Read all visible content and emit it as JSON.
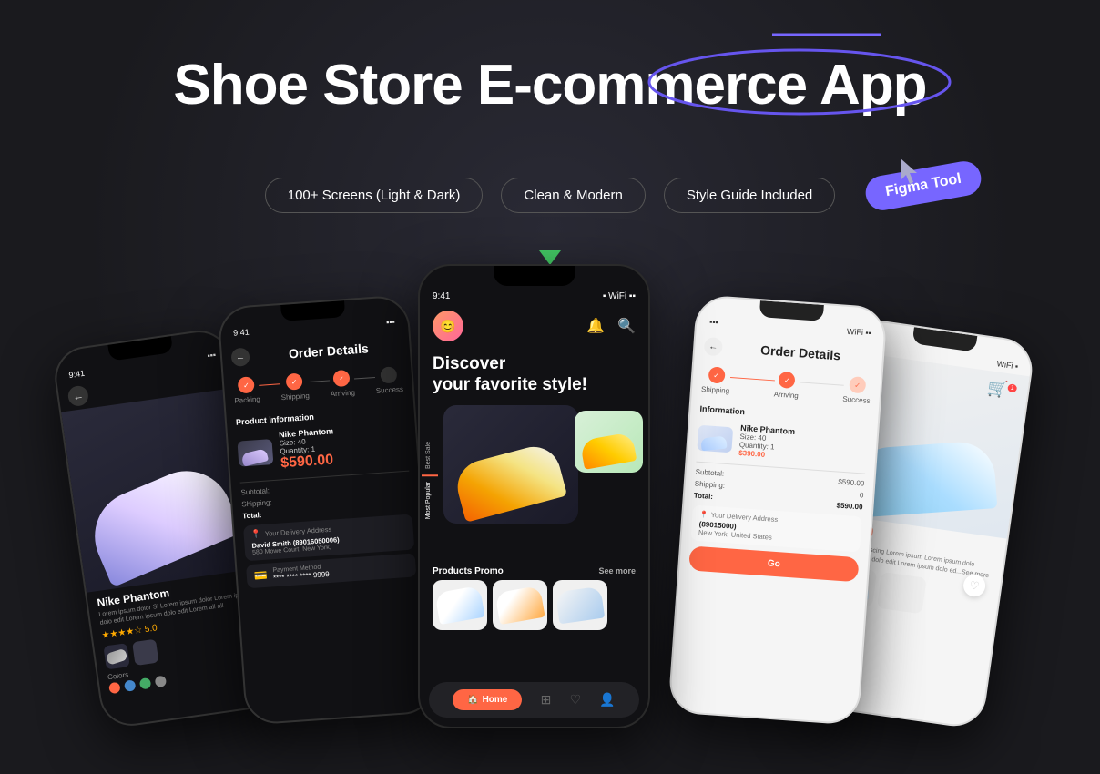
{
  "header": {
    "title": "Shoe Store E-commerce App",
    "title_line1": "Shoe Store E-commerce App"
  },
  "badges": [
    {
      "label": "100+ Screens (Light & Dark)"
    },
    {
      "label": "Clean & Modern"
    },
    {
      "label": "Style Guide Included"
    }
  ],
  "figma_tag": "Figma Tool",
  "phones": {
    "center": {
      "time": "9:41",
      "hero_text_line1": "Discover",
      "hero_text_line2": "your favorite style!",
      "categories": [
        "Best Sale",
        "Most Popular"
      ],
      "products_promo_label": "Products Promo",
      "see_more": "See more",
      "nav_home": "Home"
    },
    "left": {
      "time": "9:41",
      "title": "Order Details",
      "steps": [
        "Packing",
        "Shipping",
        "Arriving",
        "Success"
      ],
      "section_title": "Product information",
      "product_name": "Nike Phantom",
      "product_size": "Size: 40",
      "product_qty": "Quantity: 1",
      "product_price": "$590.00",
      "subtotal_label": "Subtotal:",
      "shipping_label": "Shipping:",
      "total_label": "Total:",
      "addr_placeholder": "Your Delivery Address",
      "addr_name": "David Smith (89016050006)",
      "addr_line": "580 Mowe Court, New York,",
      "payment_placeholder": "Payment Method",
      "card_number": "**** **** **** 9999"
    },
    "right": {
      "title": "Order Details",
      "steps": [
        "Shipping",
        "Arriving",
        "Success"
      ],
      "section_label": "Information",
      "product_name": "Nike Phantom",
      "product_size": "Size: 40",
      "product_qty": "Quantity: 1",
      "product_price": "$390.00",
      "subtotal_val": "$590.00",
      "shipping_val": "0",
      "total_val": "$590.00"
    },
    "far_left": {
      "time": "9:41",
      "shoe_name": "Nike Phantom",
      "description": "Lorem ipsum dolor Si Lorem ipsum dolor Lorem ipsum dolo edit Lorem ipsum dolo edit Lorem all all",
      "colors_label": "Colors"
    },
    "far_right": {
      "price": "$200",
      "description": "special adipiscing Lorem ipsum Lorem ipsum dolo Lorem ipsum dolo edit Lorem ipsum dolo ed...See more"
    }
  },
  "colors": {
    "bg": "#1a1a1e",
    "accent": "#7766ff",
    "orange": "#ff6644",
    "green": "#44cc66"
  }
}
